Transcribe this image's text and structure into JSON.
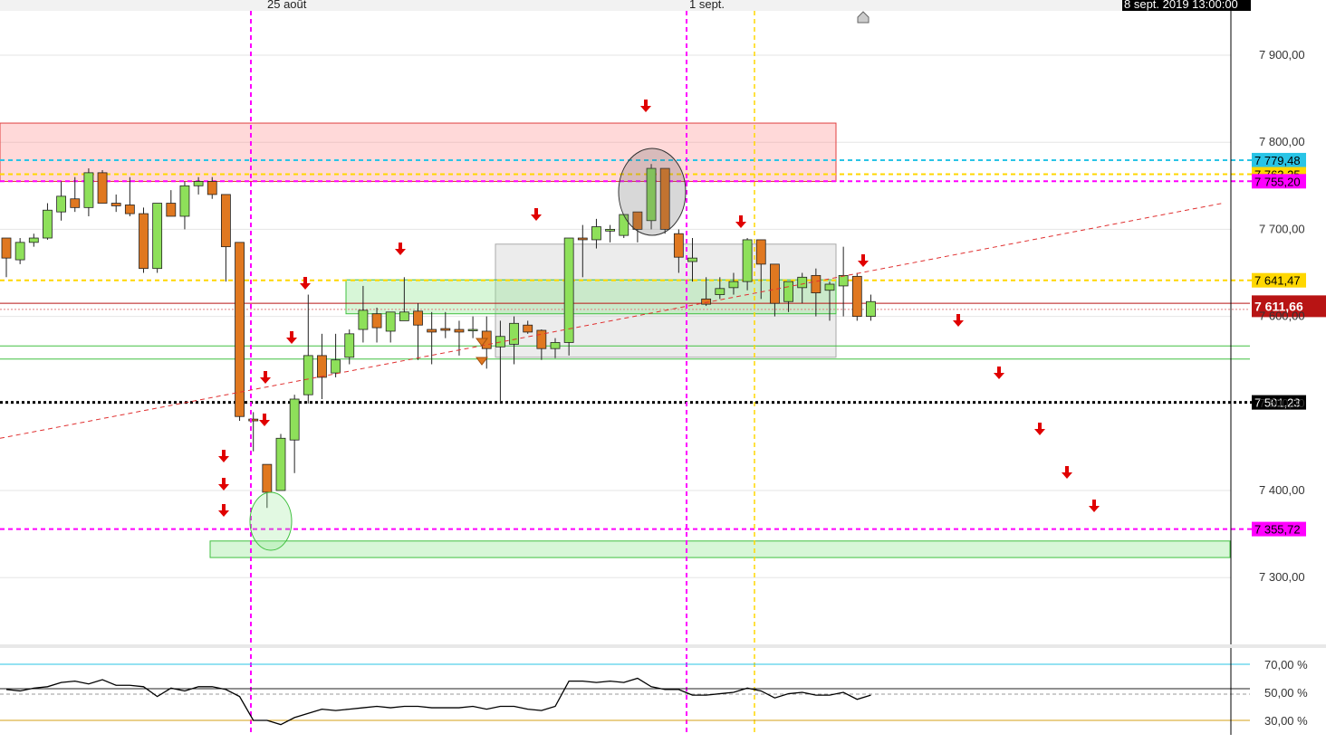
{
  "header": {
    "date_labels": [
      "25 août",
      "1 sept."
    ],
    "timestamp": "8 sept. 2019 13:00:00"
  },
  "colors": {
    "bull": "#8ee05a",
    "bear": "#e07820",
    "magenta": "#ff00ff",
    "cyan": "#29c4e6",
    "yellow": "#ffd700",
    "red_arrow": "#e00000",
    "price_tag": "#b81414",
    "black": "#000000"
  },
  "chart_data": [
    {
      "type": "candlestick",
      "ylim": [
        7220,
        7960
      ],
      "y_ticks": [
        7300,
        7400,
        7500,
        7600,
        7700,
        7800,
        7900
      ],
      "y_tick_labels": [
        "7 300,00",
        "7 400,00",
        "7 500,00",
        "7 600,00",
        "7 700,00",
        "7 800,00",
        "7 900,00"
      ],
      "candles": [
        [
          7690,
          7690,
          7645,
          7667
        ],
        [
          7665,
          7690,
          7660,
          7685
        ],
        [
          7685,
          7695,
          7680,
          7690
        ],
        [
          7690,
          7730,
          7688,
          7722
        ],
        [
          7720,
          7755,
          7710,
          7738
        ],
        [
          7735,
          7760,
          7720,
          7725
        ],
        [
          7725,
          7770,
          7715,
          7765
        ],
        [
          7765,
          7768,
          7730,
          7730
        ],
        [
          7730,
          7740,
          7720,
          7727
        ],
        [
          7728,
          7760,
          7715,
          7718
        ],
        [
          7718,
          7725,
          7650,
          7655
        ],
        [
          7655,
          7730,
          7650,
          7730
        ],
        [
          7730,
          7745,
          7715,
          7715
        ],
        [
          7715,
          7755,
          7700,
          7750
        ],
        [
          7750,
          7760,
          7740,
          7755
        ],
        [
          7755,
          7760,
          7735,
          7740
        ],
        [
          7740,
          7740,
          7640,
          7680
        ],
        [
          7685,
          7685,
          7480,
          7485
        ],
        [
          7482,
          7490,
          7445,
          7480
        ],
        [
          7430,
          7430,
          7380,
          7398
        ],
        [
          7400,
          7465,
          7405,
          7460
        ],
        [
          7458,
          7510,
          7420,
          7505
        ],
        [
          7510,
          7625,
          7500,
          7555
        ],
        [
          7555,
          7580,
          7505,
          7530
        ],
        [
          7535,
          7580,
          7530,
          7550
        ],
        [
          7553,
          7585,
          7545,
          7580
        ],
        [
          7585,
          7635,
          7570,
          7607
        ],
        [
          7603,
          7610,
          7570,
          7587
        ],
        [
          7583,
          7605,
          7570,
          7605
        ],
        [
          7595,
          7645,
          7595,
          7605
        ],
        [
          7606,
          7615,
          7550,
          7590
        ],
        [
          7585,
          7605,
          7545,
          7582
        ],
        [
          7586,
          7605,
          7575,
          7584
        ],
        [
          7585,
          7595,
          7555,
          7582
        ],
        [
          7584,
          7600,
          7575,
          7585
        ],
        [
          7583,
          7600,
          7540,
          7563
        ],
        [
          7565,
          7595,
          7500,
          7577
        ],
        [
          7568,
          7600,
          7545,
          7592
        ],
        [
          7590,
          7595,
          7580,
          7582
        ],
        [
          7584,
          7585,
          7550,
          7563
        ],
        [
          7563,
          7575,
          7552,
          7570
        ],
        [
          7570,
          7690,
          7555,
          7690
        ],
        [
          7690,
          7705,
          7645,
          7688
        ],
        [
          7688,
          7712,
          7678,
          7703
        ],
        [
          7698,
          7705,
          7685,
          7700
        ],
        [
          7693,
          7715,
          7690,
          7717
        ],
        [
          7720,
          7720,
          7685,
          7700
        ],
        [
          7710,
          7775,
          7700,
          7770
        ],
        [
          7770,
          7770,
          7695,
          7700
        ],
        [
          7695,
          7700,
          7650,
          7668
        ],
        [
          7663,
          7690,
          7640,
          7667
        ],
        [
          7620,
          7645,
          7612,
          7614
        ],
        [
          7625,
          7645,
          7620,
          7632
        ],
        [
          7633,
          7650,
          7625,
          7640
        ],
        [
          7640,
          7690,
          7630,
          7688
        ],
        [
          7688,
          7685,
          7620,
          7660
        ],
        [
          7660,
          7660,
          7600,
          7615
        ],
        [
          7617,
          7640,
          7605,
          7640
        ],
        [
          7633,
          7650,
          7615,
          7645
        ],
        [
          7647,
          7655,
          7600,
          7627
        ],
        [
          7630,
          7640,
          7595,
          7637
        ],
        [
          7635,
          7680,
          7600,
          7647
        ],
        [
          7646,
          7650,
          7595,
          7600
        ],
        [
          7600,
          7625,
          7595,
          7617
        ]
      ],
      "h_levels": [
        {
          "value": 7779.48,
          "label": "7 779,48",
          "color": "#29c4e6",
          "style": "dashed"
        },
        {
          "value": 7763.25,
          "label": "7 763,25",
          "color": "#ffd700",
          "style": "dashed"
        },
        {
          "value": 7755.2,
          "label": "7 755,20",
          "color": "#ff00ff",
          "style": "dashed"
        },
        {
          "value": 7641.47,
          "label": "7 641,47",
          "color": "#ffd700",
          "style": "dashed"
        },
        {
          "value": 7611.66,
          "label": "7 611,66",
          "color": "#b81414",
          "style": "solid"
        },
        {
          "value": 7501.23,
          "label": "7 501,23",
          "color": "#000000",
          "style": "dotted"
        },
        {
          "value": 7355.72,
          "label": "7 355,72",
          "color": "#ff00ff",
          "style": "dashed"
        }
      ],
      "current_price": 7611.66
    },
    {
      "type": "line",
      "ylim": [
        25,
        80
      ],
      "y_ticks": [
        30,
        50,
        70
      ],
      "y_tick_labels": [
        "30,00 %",
        "50,00 %",
        "70,00 %"
      ],
      "reference_lines": [
        70,
        50,
        30
      ],
      "values": [
        52,
        51,
        53,
        54,
        57,
        58,
        56,
        59,
        55,
        55,
        54,
        47,
        53,
        51,
        54,
        54,
        52,
        47,
        30,
        30,
        27,
        32,
        35,
        38,
        37,
        38,
        39,
        40,
        39,
        40,
        40,
        39,
        39,
        39,
        40,
        38,
        40,
        40,
        38,
        37,
        40,
        58,
        58,
        57,
        58,
        57,
        60,
        54,
        52,
        52,
        48,
        48,
        49,
        50,
        53,
        51,
        46,
        49,
        50,
        48,
        48,
        50,
        45,
        48
      ]
    }
  ]
}
